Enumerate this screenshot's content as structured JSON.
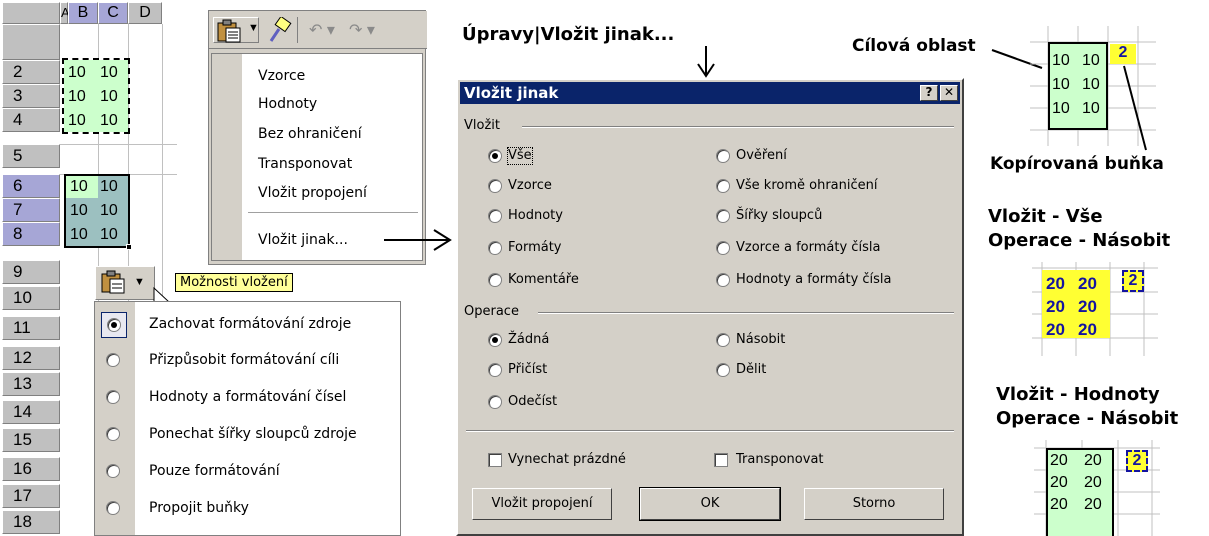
{
  "spreadsheet": {
    "columns": [
      "A",
      "B",
      "C",
      "D"
    ],
    "rows": [
      "2",
      "3",
      "4",
      "5",
      "6",
      "7",
      "8",
      "9",
      "10",
      "11",
      "12",
      "13",
      "14",
      "15",
      "16",
      "17",
      "18"
    ],
    "copied_values": [
      [
        "10",
        "10"
      ],
      [
        "10",
        "10"
      ],
      [
        "10",
        "10"
      ]
    ],
    "selected_values": [
      [
        "10",
        "10"
      ],
      [
        "10",
        "10"
      ],
      [
        "10",
        "10"
      ]
    ]
  },
  "context_menu": {
    "items": [
      "Vzorce",
      "Hodnoty",
      "Bez ohraničení",
      "Transponovat",
      "Vložit propojení"
    ],
    "paste_special": "Vložit jinak..."
  },
  "paste_options": {
    "tooltip": "Možnosti vložení",
    "items": [
      {
        "label": "Zachovat formátování zdroje",
        "checked": true
      },
      {
        "label": "Přizpůsobit formátování cíli",
        "checked": false
      },
      {
        "label": "Hodnoty a formátování čísel",
        "checked": false
      },
      {
        "label": "Ponechat šířky sloupců zdroje",
        "checked": false
      },
      {
        "label": "Pouze formátování",
        "checked": false
      },
      {
        "label": "Propojit buňky",
        "checked": false
      }
    ]
  },
  "menu_path": "Úpravy|Vložit jinak...",
  "dialog": {
    "title": "Vložit jinak",
    "help": "?",
    "close": "✕",
    "group_paste": "Vložit",
    "paste_options": [
      {
        "label": "Vše",
        "checked": true
      },
      {
        "label": "Vzorce",
        "checked": false
      },
      {
        "label": "Hodnoty",
        "checked": false
      },
      {
        "label": "Formáty",
        "checked": false
      },
      {
        "label": "Komentáře",
        "checked": false
      },
      {
        "label": "Ověření",
        "checked": false
      },
      {
        "label": "Vše kromě ohraničení",
        "checked": false
      },
      {
        "label": "Šířky sloupců",
        "checked": false
      },
      {
        "label": "Vzorce a formáty čísla",
        "checked": false
      },
      {
        "label": "Hodnoty a formáty čísla",
        "checked": false
      }
    ],
    "group_operation": "Operace",
    "operation_options": [
      {
        "label": "Žádná",
        "checked": true
      },
      {
        "label": "Přičíst",
        "checked": false
      },
      {
        "label": "Odečíst",
        "checked": false
      },
      {
        "label": "Násobit",
        "checked": false
      },
      {
        "label": "Dělit",
        "checked": false
      }
    ],
    "skip_blanks": "Vynechat prázdné",
    "transpose": "Transponovat",
    "paste_link_button": "Vložit propojení",
    "ok_button": "OK",
    "cancel_button": "Storno"
  },
  "annotations": {
    "target_area": "Cílová oblast",
    "copied_cell": "Kopírovaná buňka",
    "example1_line1": "Vložit - Vše",
    "example1_line2": "Operace - Násobit",
    "example2_line1": "Vložit - Hodnoty",
    "example2_line2": "Operace - Násobit",
    "mini_target_values": [
      [
        "10",
        "10"
      ],
      [
        "10",
        "10"
      ],
      [
        "10",
        "10"
      ]
    ],
    "mini_copied_value": "2",
    "example1_values": [
      [
        "20",
        "20"
      ],
      [
        "20",
        "20"
      ],
      [
        "20",
        "20"
      ]
    ],
    "example1_copied": "2",
    "example2_values": [
      [
        "20",
        "20"
      ],
      [
        "20",
        "20"
      ],
      [
        "20",
        "20"
      ]
    ],
    "example2_copied": "2"
  }
}
